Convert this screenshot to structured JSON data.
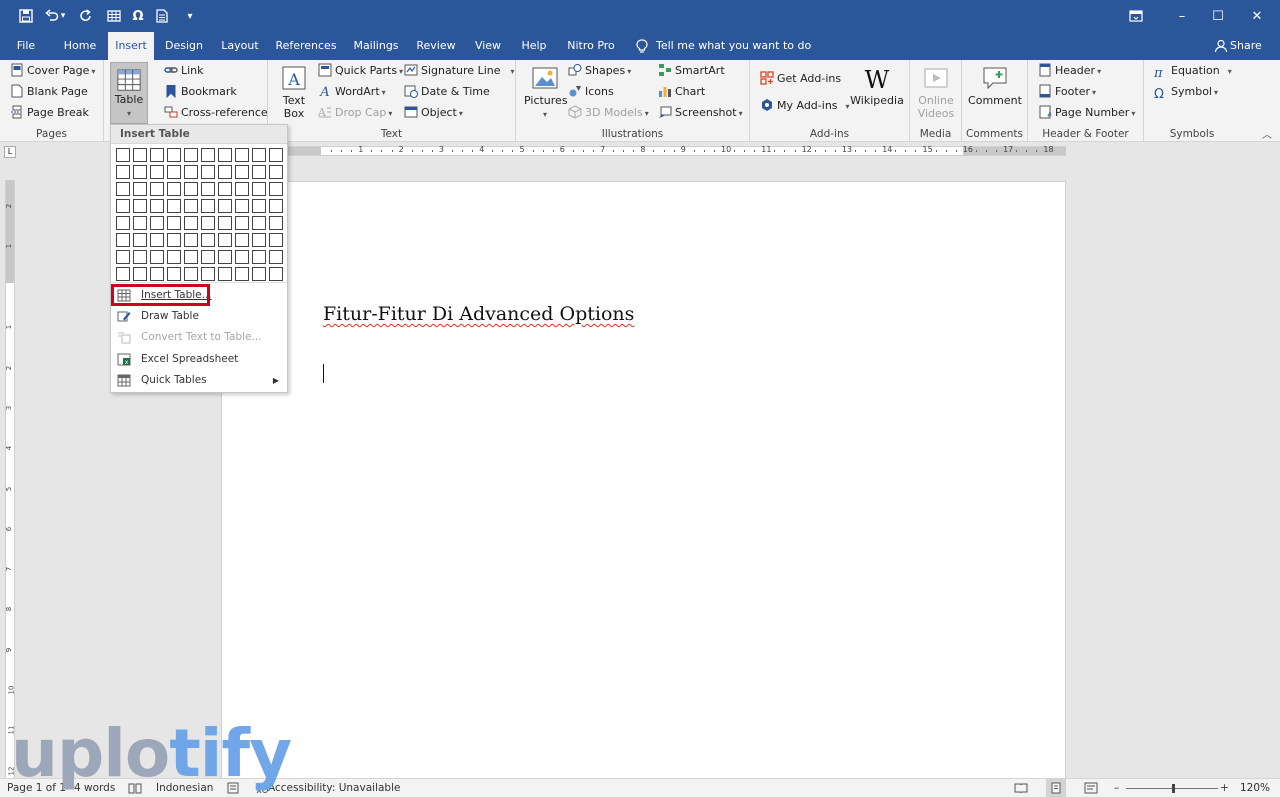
{
  "qat": {
    "save": "save-icon",
    "undo": "undo-icon",
    "undo_more": "▾",
    "redo": "repeat-icon",
    "table": "table-icon",
    "symbol": "Ω",
    "doc": "document-icon",
    "customize": "▾"
  },
  "window": {
    "restore_ribbon": "ribbon-display-icon",
    "minimize": "–",
    "maximize": "☐",
    "close": "✕"
  },
  "tabs": [
    "File",
    "Home",
    "Insert",
    "Design",
    "Layout",
    "References",
    "Mailings",
    "Review",
    "View",
    "Help",
    "Nitro Pro"
  ],
  "active_tab": "Insert",
  "tell_me": "Tell me what you want to do",
  "share": "Share",
  "ribbon": {
    "pages": {
      "label": "Pages",
      "items": [
        "Cover Page",
        "Blank Page",
        "Page Break"
      ]
    },
    "tables": {
      "label": "Table"
    },
    "links": {
      "items": [
        "Link",
        "Bookmark",
        "Cross-reference"
      ]
    },
    "text": {
      "label": "Text",
      "textbox": "Text Box",
      "items": [
        "Quick Parts",
        "WordArt",
        "Drop Cap",
        "Signature Line",
        "Date & Time",
        "Object"
      ]
    },
    "illustrations": {
      "label": "Illustrations",
      "pictures": "Pictures",
      "items": [
        "Shapes",
        "Icons",
        "3D Models",
        "SmartArt",
        "Chart",
        "Screenshot"
      ]
    },
    "addins": {
      "label": "Add-ins",
      "items": [
        "Get Add-ins",
        "My Add-ins"
      ],
      "wikipedia": "Wikipedia"
    },
    "media": {
      "label": "Media",
      "online_videos": "Online Videos"
    },
    "comments": {
      "label": "Comments",
      "comment": "Comment"
    },
    "header_footer": {
      "label": "Header & Footer",
      "items": [
        "Header",
        "Footer",
        "Page Number"
      ]
    },
    "symbols": {
      "label": "Symbols",
      "items": [
        "Equation",
        "Symbol"
      ]
    }
  },
  "dropdown": {
    "title": "Insert Table",
    "grid_cols": 10,
    "grid_rows": 8,
    "items": [
      {
        "label": "Insert Table...",
        "disabled": false,
        "highlighted": true
      },
      {
        "label": "Draw Table",
        "disabled": false
      },
      {
        "label": "Convert Text to Table...",
        "disabled": true
      },
      {
        "label": "Excel Spreadsheet",
        "disabled": false
      },
      {
        "label": "Quick Tables",
        "disabled": false,
        "submenu": true
      }
    ]
  },
  "ruler": {
    "numbers": [
      "1",
      "2",
      "3",
      "4",
      "5",
      "6",
      "7",
      "8",
      "9",
      "10",
      "11",
      "12",
      "13",
      "14",
      "15",
      "16",
      "17",
      "18"
    ],
    "vnumbers": [
      "2",
      "1",
      "1",
      "2",
      "3",
      "4",
      "5",
      "6",
      "7",
      "8",
      "9",
      "10",
      "11",
      "12"
    ]
  },
  "document": {
    "heading": "Fitur-Fitur Di Advanced Options"
  },
  "status": {
    "page": "Page 1 of 1",
    "words": "4 words",
    "language": "Indonesian",
    "accessibility": "Accessibility: Unavailable",
    "zoom": "120%",
    "zoom_minus": "–",
    "zoom_plus": "+"
  },
  "watermark": {
    "part1": "uplo",
    "part2": "tify"
  },
  "colors": {
    "title_bar": "#2b579a",
    "ribbon": "#f3f3f3",
    "highlight_box": "#d0021b",
    "squiggle": "#e0301e"
  }
}
